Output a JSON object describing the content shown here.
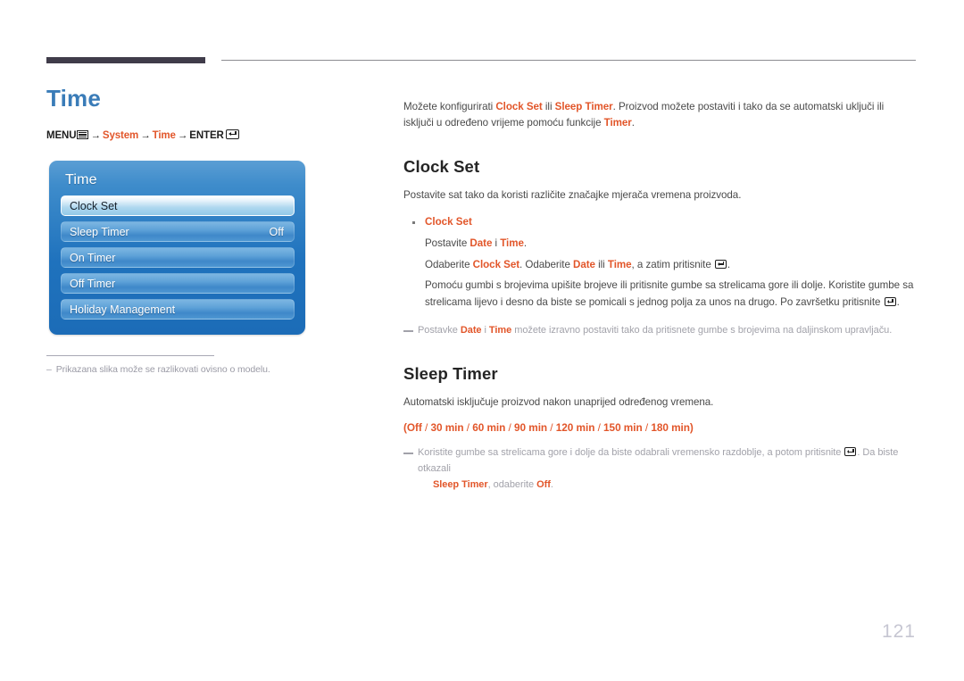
{
  "page": {
    "title": "Time",
    "number": "121"
  },
  "breadcrumb": {
    "menu_label": "MENU",
    "menu_icon": "menu-bars-icon",
    "arrow": "→",
    "item1": "System",
    "item2": "Time",
    "enter_label": "ENTER",
    "enter_icon": "enter-return-icon"
  },
  "osd": {
    "title": "Time",
    "rows": [
      {
        "label": "Clock Set",
        "value": "",
        "selected": true
      },
      {
        "label": "Sleep Timer",
        "value": "Off",
        "selected": false
      },
      {
        "label": "On Timer",
        "value": "",
        "selected": false
      },
      {
        "label": "Off Timer",
        "value": "",
        "selected": false
      },
      {
        "label": "Holiday Management",
        "value": "",
        "selected": false
      }
    ],
    "note_dash": "–",
    "note": "Prikazana slika može se razlikovati ovisno o modelu."
  },
  "intro": {
    "t1": "Možete konfigurirati ",
    "b1": "Clock Set",
    "t2": " ili ",
    "b2": "Sleep Timer",
    "t3": ". Proizvod možete postaviti i tako da se automatski uključi ili isključi u određeno vrijeme pomoću funkcije ",
    "b3": "Timer",
    "t4": "."
  },
  "clock_set": {
    "heading": "Clock Set",
    "sub": "Postavite sat tako da koristi različite značajke mjerača vremena proizvoda.",
    "bullet_title": "Clock Set",
    "line1_a": "Postavite ",
    "line1_b1": "Date",
    "line1_b": " i ",
    "line1_b2": "Time",
    "line1_c": ".",
    "line2_a": "Odaberite ",
    "line2_b1": "Clock Set",
    "line2_b": ". Odaberite ",
    "line2_b2": "Date",
    "line2_c": " ili ",
    "line2_b3": "Time",
    "line2_d": ", a zatim pritisnite ",
    "line2_e": ".",
    "line3": "Pomoću gumbi s brojevima upišite brojeve ili pritisnite gumbe sa strelicama gore ili dolje. Koristite gumbe sa strelicama lijevo i desno da biste se pomicali s jednog polja za unos na drugo. Po završetku pritisnite ",
    "line3_end": ".",
    "note_a": "Postavke ",
    "note_b1": "Date",
    "note_b": " i ",
    "note_b2": "Time",
    "note_c": " možete izravno postaviti tako da pritisnete gumbe s brojevima na daljinskom upravljaču."
  },
  "sleep_timer": {
    "heading": "Sleep Timer",
    "sub": "Automatski isključuje proizvod nakon unaprijed određenog vremena.",
    "options_open": "(",
    "options": [
      "Off",
      "30 min",
      "60 min",
      "90 min",
      "120 min",
      "150 min",
      "180 min"
    ],
    "options_sep": " / ",
    "options_close": ")",
    "note_a": "Koristite gumbe sa strelicama gore i dolje da biste odabrali vremensko razdoblje, a potom pritisnite ",
    "note_b": ". Da biste otkazali ",
    "note_b1": "Sleep Timer",
    "note_c": ", odaberite ",
    "note_b2": "Off",
    "note_d": "."
  },
  "colors": {
    "accent_orange": "#e2562a",
    "title_blue": "#3a7cb8",
    "rule_dark": "#403c4a",
    "osd_blue": "#1f72bd",
    "page_number": "#c6c6d2"
  }
}
